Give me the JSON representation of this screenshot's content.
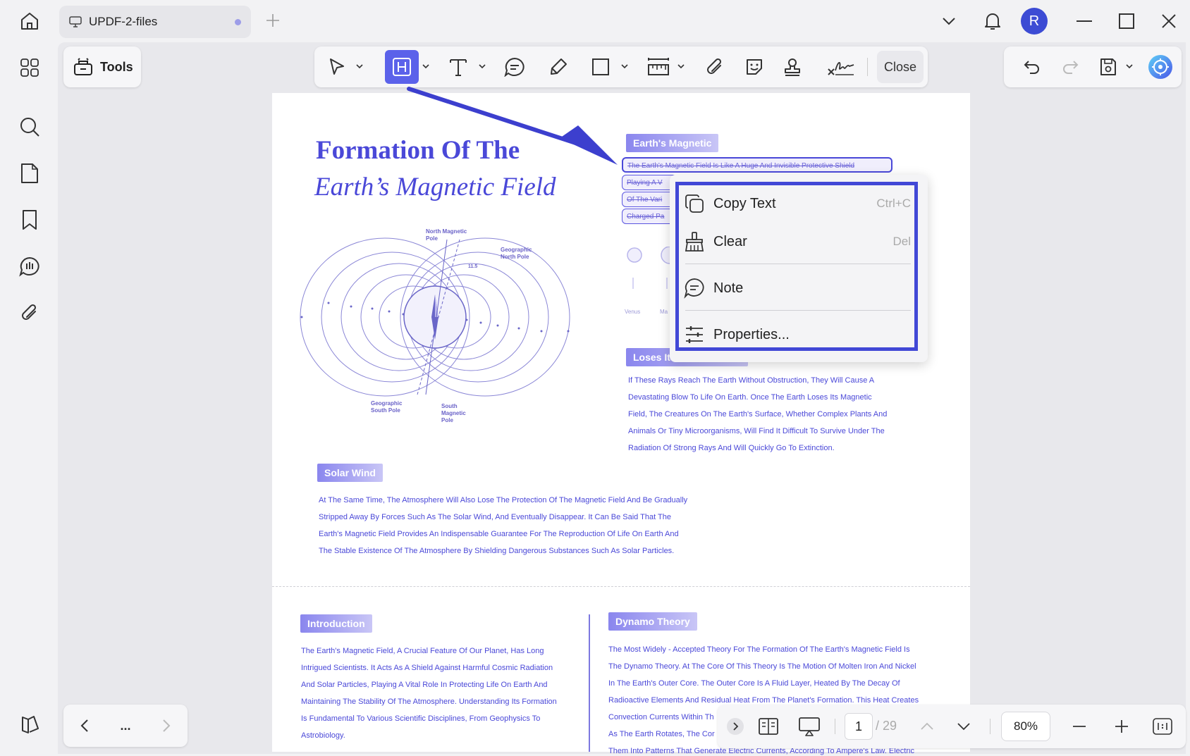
{
  "window": {
    "tab_title": "UPDF-2-files",
    "avatar_letter": "R"
  },
  "toolbar": {
    "tools_label": "Tools",
    "close_label": "Close"
  },
  "document": {
    "title_line1": "Formation Of The",
    "title_line2": "Earth’s Magnetic Field",
    "section_magnetic": "Earth's Magnetic",
    "highlight_lines": [
      "The Earth's Magnetic Field Is Like A Huge And Invisible Protective Shield",
      "Playing A V",
      "Of The Vari",
      "Charged Pa"
    ],
    "diagram_labels": {
      "north_magnetic": "North Magnetic Pole",
      "geo_north": "Geographic North Pole",
      "geo_south": "Geographic South Pole",
      "south_magnetic": "South Magnetic Pole",
      "angle": "11.5",
      "venus": "Venus",
      "mars_partial": "Ma"
    },
    "section_loses": "Loses It",
    "loses_paragraph": [
      "If These Rays Reach The Earth Without Obstruction, They Will Cause A",
      "Devastating Blow To Life On Earth. Once The Earth Loses Its Magnetic",
      "Field, The Creatures On The Earth's Surface, Whether Complex Plants And",
      "Animals Or Tiny Microorganisms, Will Find It Difficult To Survive Under The",
      "Radiation Of Strong Rays And Will Quickly Go To Extinction."
    ],
    "section_solar": "Solar Wind",
    "solar_paragraph": [
      "At The Same Time, The Atmosphere Will Also Lose The Protection Of The Magnetic Field And Be Gradually",
      "Stripped Away By Forces Such As The Solar Wind, And Eventually Disappear. It Can Be Said That The",
      "Earth's Magnetic Field Provides An Indispensable Guarantee For The Reproduction Of Life On Earth And",
      "The Stable Existence Of The Atmosphere By Shielding Dangerous Substances Such As Solar Particles."
    ],
    "section_intro": "Introduction",
    "intro_paragraph": [
      "The Earth's Magnetic Field, A Crucial Feature Of Our Planet, Has Long",
      "Intrigued Scientists. It Acts As A Shield Against Harmful Cosmic Radiation",
      "And Solar Particles, Playing A Vital Role In Protecting Life On Earth And",
      "Maintaining The Stability Of The Atmosphere. Understanding Its Formation",
      "Is Fundamental To Various Scientific Disciplines, From Geophysics To",
      "Astrobiology."
    ],
    "section_dynamo": "Dynamo Theory",
    "dynamo_paragraph": [
      "The Most Widely - Accepted Theory For The Formation Of The Earth's Magnetic Field Is",
      "The Dynamo Theory. At The Core Of This Theory Is The Motion Of Molten Iron And Nickel",
      "In The Earth's Outer Core. The Outer Core Is A Fluid Layer, Heated By The Decay Of",
      "Radioactive Elements And Residual Heat From The Planet's Formation. This Heat Creates",
      "Convection Currents Within Th",
      "As The Earth Rotates, The Cor",
      "Them Into Patterns That Generate Electric Currents, According To Ampere's Law. Electric"
    ]
  },
  "context_menu": {
    "items": [
      {
        "label": "Copy Text",
        "shortcut": "Ctrl+C",
        "icon": "copy-icon"
      },
      {
        "label": "Clear",
        "shortcut": "Del",
        "icon": "broom-icon"
      },
      {
        "label": "Note",
        "shortcut": "",
        "icon": "comment-icon"
      },
      {
        "label": "Properties...",
        "shortcut": "",
        "icon": "sliders-icon"
      }
    ]
  },
  "pagination": {
    "current": "1",
    "total": "/ 29",
    "zoom": "80%",
    "ellipsis": "..."
  },
  "colors": {
    "accent": "#4a48d8",
    "highlight_active": "#5b62ea",
    "menu_frame": "#4148d6"
  }
}
